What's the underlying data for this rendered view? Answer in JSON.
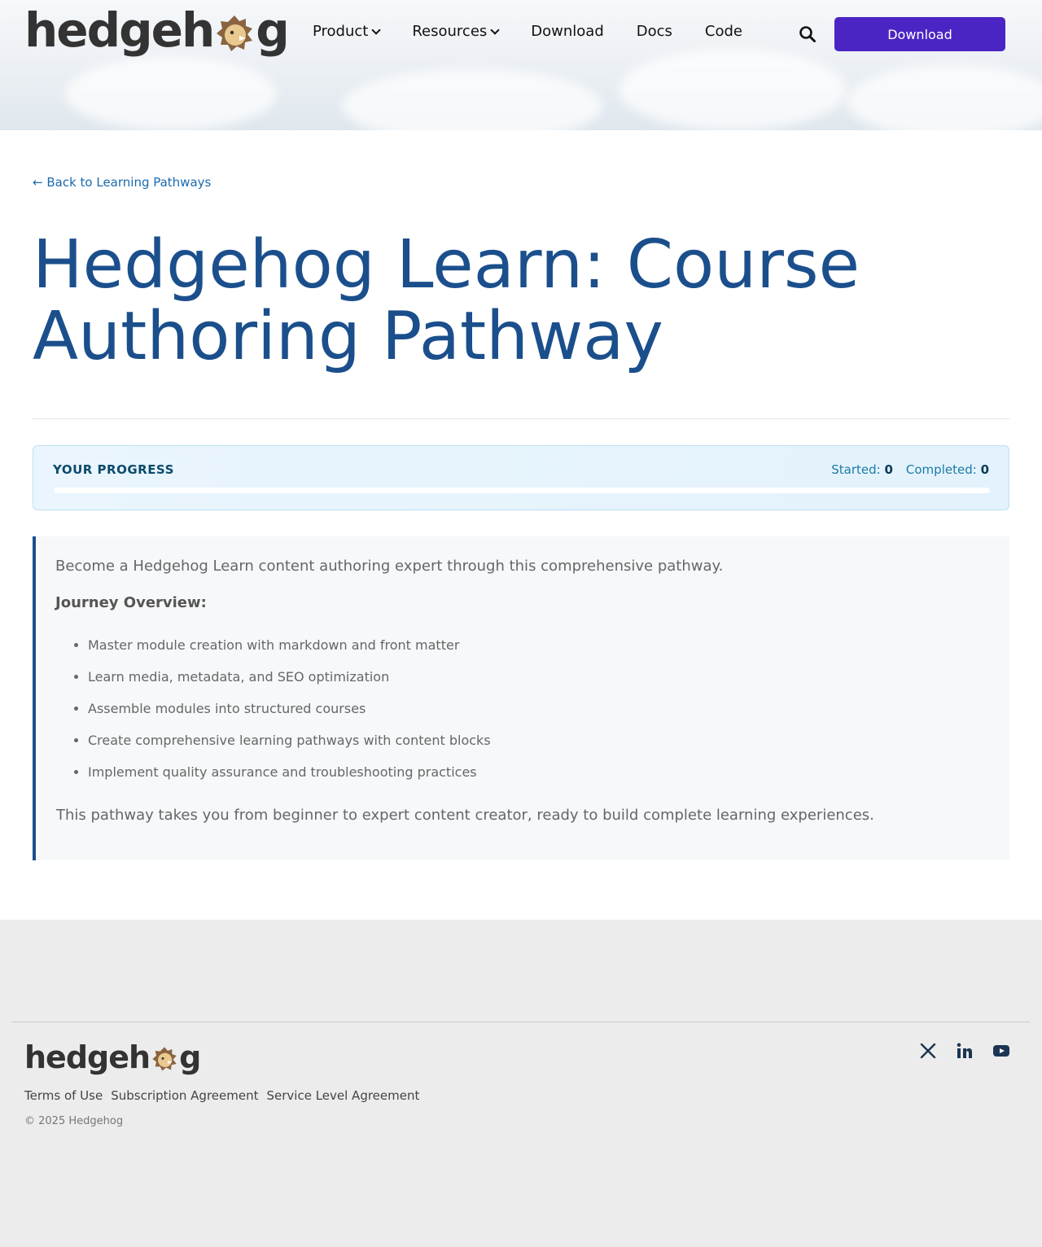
{
  "brand": {
    "logo_text_left": "hedgeh",
    "logo_text_right": "g",
    "accent": "#4b24c4",
    "title_color": "#1b4f8c"
  },
  "nav": {
    "items": [
      {
        "label": "Product",
        "dropdown": true
      },
      {
        "label": "Resources",
        "dropdown": true
      },
      {
        "label": "Download",
        "dropdown": false
      },
      {
        "label": "Docs",
        "dropdown": false
      },
      {
        "label": "Code",
        "dropdown": false
      }
    ],
    "search_icon": "search-icon",
    "cta_label": "Download"
  },
  "main": {
    "back_link": "← Back to Learning Pathways",
    "title": "Hedgehog Learn: Course Authoring Pathway",
    "progress": {
      "heading": "YOUR PROGRESS",
      "started_label": "Started:",
      "started_value": "0",
      "completed_label": "Completed:",
      "completed_value": "0",
      "fraction": 0
    },
    "overview": {
      "intro": "Become a Hedgehog Learn content authoring expert through this comprehensive pathway.",
      "heading": "Journey Overview:",
      "items": [
        "Master module creation with markdown and front matter",
        "Learn media, metadata, and SEO optimization",
        "Assemble modules into structured courses",
        "Create comprehensive learning pathways with content blocks",
        "Implement quality assurance and troubleshooting practices"
      ],
      "outro": "This pathway takes you from beginner to expert content creator, ready to build complete learning experiences."
    }
  },
  "footer": {
    "links": [
      "Terms of Use",
      "Subscription Agreement",
      "Service Level Agreement"
    ],
    "copyright": "© 2025 Hedgehog",
    "social": [
      "x-icon",
      "linkedin-icon",
      "youtube-icon"
    ]
  }
}
